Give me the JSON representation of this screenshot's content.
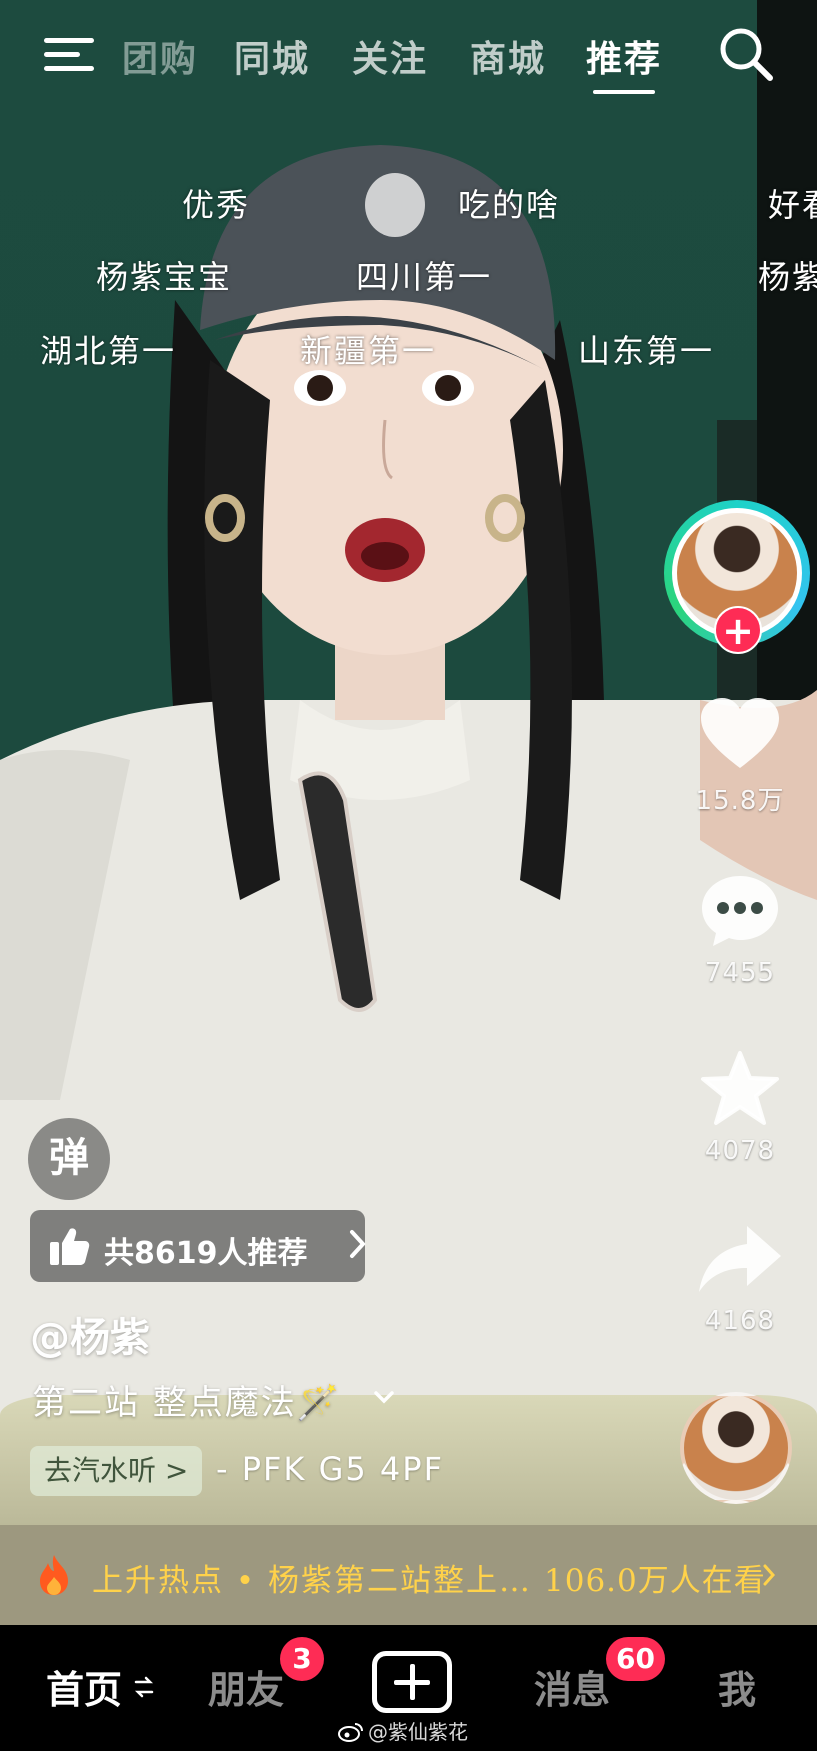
{
  "top_nav": {
    "tabs": [
      {
        "label": "团购",
        "state": "faded"
      },
      {
        "label": "同城",
        "state": "normal"
      },
      {
        "label": "关注",
        "state": "normal"
      },
      {
        "label": "商城",
        "state": "normal"
      },
      {
        "label": "推荐",
        "state": "active"
      }
    ],
    "menu_icon": "hamburger-menu-icon",
    "search_icon": "search-icon"
  },
  "danmaku": [
    {
      "text": "优秀"
    },
    {
      "text": "吃的啥"
    },
    {
      "text": "好看"
    },
    {
      "text": "杨紫宝宝"
    },
    {
      "text": "四川第一"
    },
    {
      "text": "杨紫"
    },
    {
      "text": "湖北第一"
    },
    {
      "text": "新疆第一"
    },
    {
      "text": "山东第一"
    }
  ],
  "right_rail": {
    "follow_label": "+",
    "like_count": "15.8万",
    "comment_count": "7455",
    "favorite_count": "4078",
    "share_count": "4168"
  },
  "overlay": {
    "danmu_toggle": "弹",
    "recommend_text": "共8619人推荐",
    "author": "@杨紫",
    "caption": "第二站 整点魔法🪄",
    "music_pill": "去汽水听 >",
    "music_title": "- PFK G5   4PF"
  },
  "hot_bar": {
    "text": "上升热点 • 杨紫第二站整上…",
    "viewers": "106.0万人在看"
  },
  "bottom_tabs": {
    "home": "首页",
    "friends": "朋友",
    "friends_badge": "3",
    "messages": "消息",
    "messages_badge": "60",
    "me": "我"
  },
  "watermark": "@紫仙紫花",
  "colors": {
    "accent_red": "#fe2c55",
    "hot_yellow": "#ffd24a",
    "avatar_ring": "#1ed2c8"
  }
}
